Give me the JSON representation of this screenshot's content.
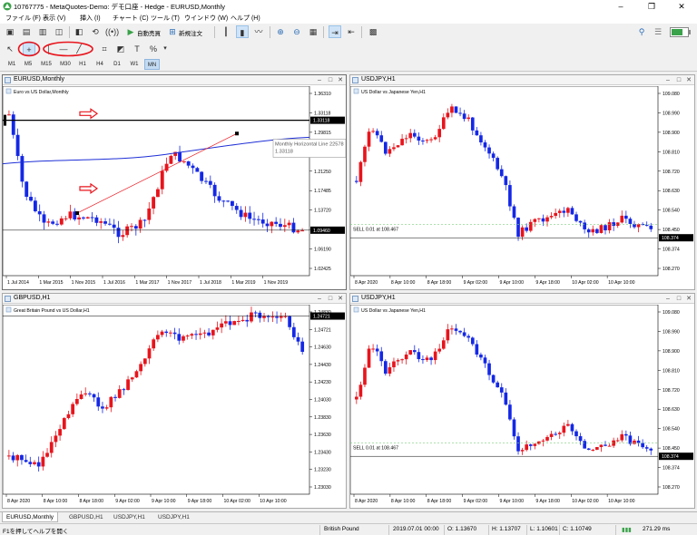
{
  "window": {
    "title": "10767775 - MetaQuotes-Demo: デモ口座 - Hedge - EURUSD,Monthly"
  },
  "menu": [
    "ファイル (F)",
    "表示 (V)",
    "挿入 (I)",
    "チャート (C)",
    "ツール (T)",
    "ウインドウ (W)",
    "ヘルプ (H)"
  ],
  "toolbar": {
    "auto_trading_label": "自動売買",
    "new_order_label": "新規注文",
    "timeframes": [
      "M1",
      "M5",
      "M15",
      "M30",
      "H1",
      "H4",
      "D1",
      "W1",
      "MN"
    ],
    "selected_timeframe": "MN"
  },
  "charts": [
    {
      "window_title": "EURUSD,Monthly",
      "symbol_desc": "Euro vs US Dollar,Monthly",
      "price_labels": [
        "1.36310",
        "1.33118",
        "1.29815",
        "1.25015",
        "1.21250",
        "1.17485",
        "1.13720",
        "1.09460",
        "1.06190",
        "1.02425"
      ],
      "time_labels": [
        "1 Jul 2014",
        "1 Mar 2015",
        "1 Nov 2015",
        "1 Jul 2016",
        "1 Mar 2017",
        "1 Nov 2017",
        "1 Jul 2018",
        "1 Mar 2019",
        "1 Nov 2019"
      ],
      "current_price": "1.09460",
      "hline_price": "1.33118",
      "tooltip_title": "Monthly Horizontal Line 22578",
      "tooltip_value": "1.33118"
    },
    {
      "window_title": "USDJPY,H1",
      "symbol_desc": "US Dollar vs Japanese Yen,H1",
      "price_labels": [
        "109.080",
        "108.990",
        "108.900",
        "108.810",
        "108.720",
        "108.630",
        "108.540",
        "108.450",
        "108.374",
        "108.270"
      ],
      "time_labels": [
        "8 Apr 2020",
        "8 Apr 10:00",
        "8 Apr 18:00",
        "9 Apr 02:00",
        "9 Apr 10:00",
        "9 Apr 18:00",
        "10 Apr 02:00",
        "10 Apr 10:00"
      ],
      "current_price": "108.374",
      "sell_label": "SELL 0.01 at 108.467"
    },
    {
      "window_title": "GBPUSD,H1",
      "symbol_desc": "Great Britain Pound vs US Dollar,H1",
      "price_labels": [
        "1.24830",
        "1.24721",
        "1.24630",
        "1.24430",
        "1.24230",
        "1.24030",
        "1.23830",
        "1.23630",
        "1.23430",
        "1.23230",
        "1.23030"
      ],
      "time_labels": [
        "8 Apr 2020",
        "8 Apr 10:00",
        "8 Apr 18:00",
        "9 Apr 02:00",
        "9 Apr 10:00",
        "9 Apr 18:00",
        "10 Apr 02:00",
        "10 Apr 10:00"
      ],
      "current_price": "1.24721"
    },
    {
      "window_title": "USDJPY,H1",
      "symbol_desc": "US Dollar vs Japanese Yen,H1",
      "price_labels": [
        "109.080",
        "108.990",
        "108.900",
        "108.810",
        "108.720",
        "108.630",
        "108.540",
        "108.450",
        "108.374",
        "108.270"
      ],
      "time_labels": [
        "8 Apr 2020",
        "8 Apr 10:00",
        "8 Apr 18:00",
        "9 Apr 02:00",
        "9 Apr 10:00",
        "9 Apr 18:00",
        "10 Apr 02:00",
        "10 Apr 10:00"
      ],
      "current_price": "108.374",
      "sell_label": "SELL 0.01 at 108.467"
    }
  ],
  "tabs": [
    "EURUSD,Monthly",
    "GBPUSD,H1",
    "USDJPY,H1",
    "USDJPY,H1"
  ],
  "status": {
    "help": "F1を押してヘルプを開く",
    "symbol": "British Pound",
    "datetime": "2019.07.01 00:00",
    "open": "O: 1.13670",
    "high": "H: 1.13707",
    "low": "L: 1.10601",
    "close": "C: 1.10749",
    "ping": "271.29 ms"
  },
  "colors": {
    "bull": "#e8141c",
    "bear": "#1428e6",
    "ma": "#1e2fd6",
    "annotation": "#e8141c",
    "sell_line": "#7ed07e"
  }
}
